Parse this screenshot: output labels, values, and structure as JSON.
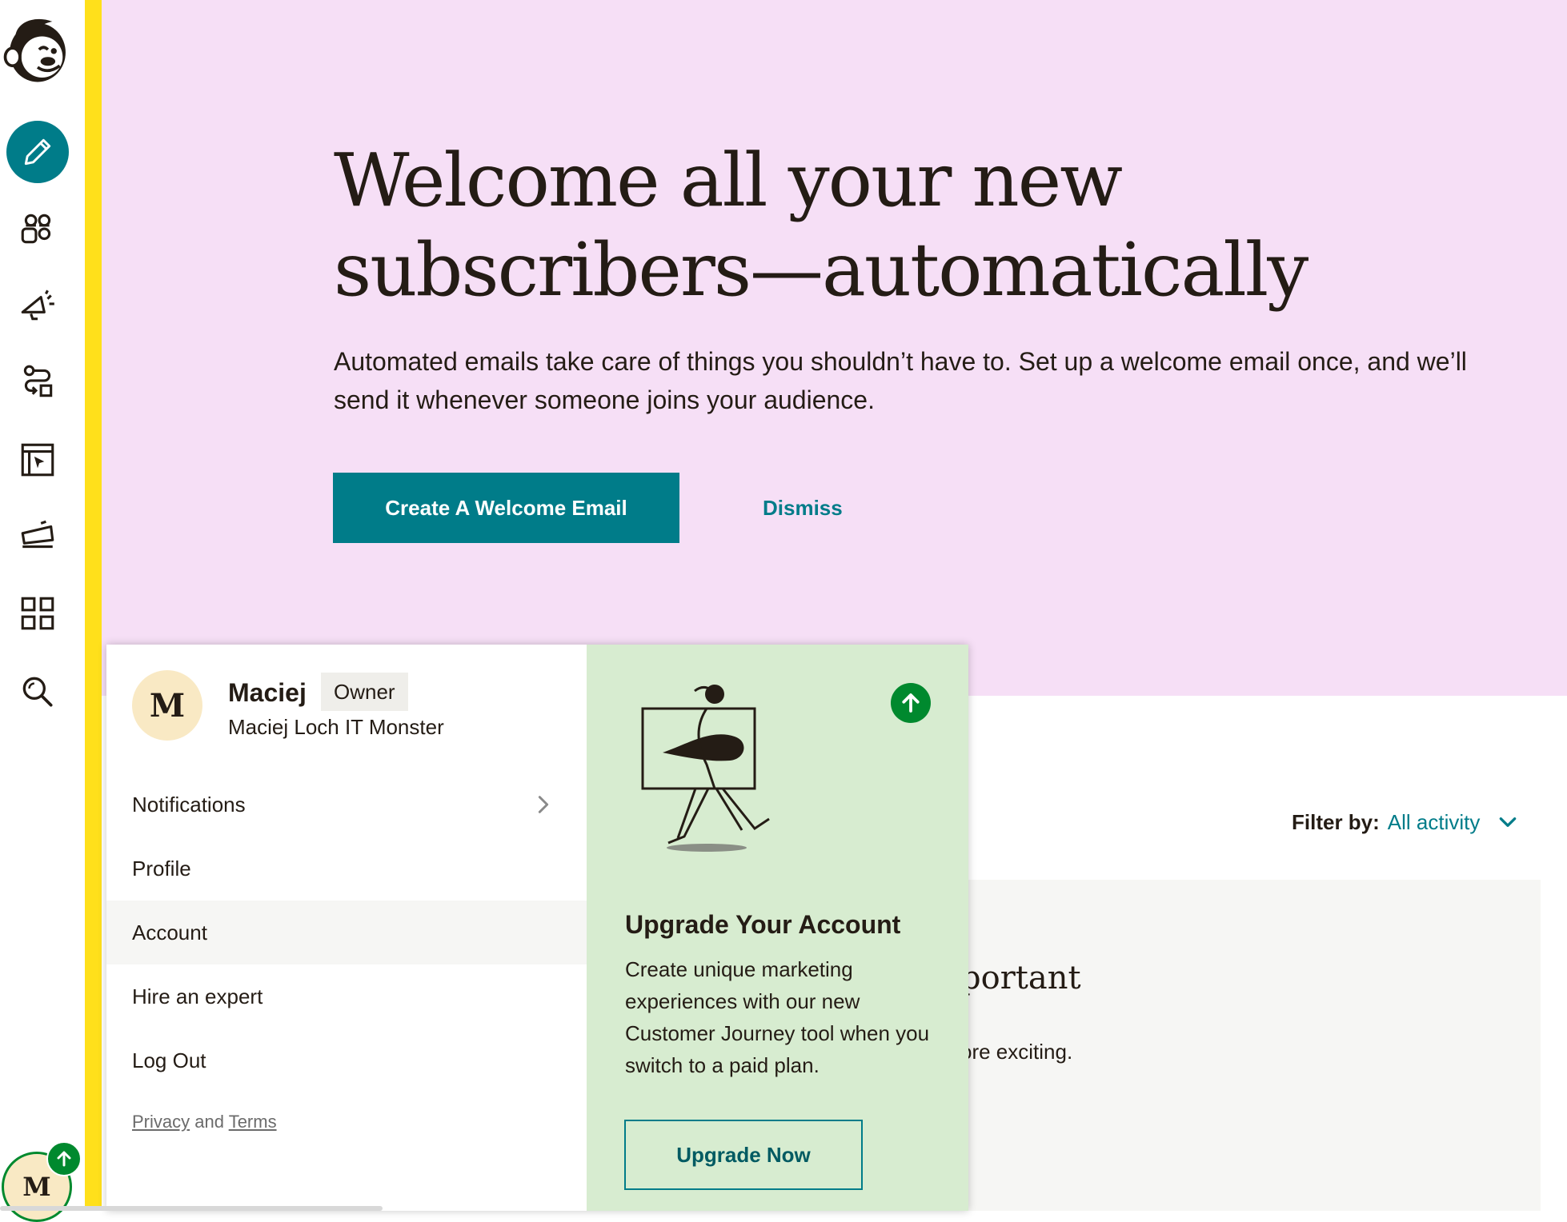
{
  "colors": {
    "accent": "#007c89",
    "yellow_stripe": "#ffe01b",
    "hero_bg": "#f6dff6",
    "upgrade_bg": "#d7ecd0",
    "success": "#00892e"
  },
  "nav": {
    "items": [
      {
        "name": "create",
        "icon": "pencil-icon"
      },
      {
        "name": "audience",
        "icon": "audience-icon"
      },
      {
        "name": "campaigns",
        "icon": "megaphone-icon"
      },
      {
        "name": "automations",
        "icon": "automation-icon"
      },
      {
        "name": "website",
        "icon": "website-cursor-icon"
      },
      {
        "name": "content",
        "icon": "content-icon"
      },
      {
        "name": "integrations",
        "icon": "grid-icon"
      },
      {
        "name": "search",
        "icon": "search-icon"
      }
    ],
    "avatar_initial": "M"
  },
  "hero": {
    "title": "Welcome all your new subscribers—automatically",
    "body": "Automated emails take care of things you shouldn’t have to. Set up a welcome email once, and we’ll send it whenever someone joins your audience.",
    "cta_label": "Create A Welcome Email",
    "dismiss_label": "Dismiss"
  },
  "filter": {
    "label": "Filter by:",
    "value": "All activity"
  },
  "activity": {
    "heading_fragment": "portant",
    "text_fragment": "ore exciting."
  },
  "account_menu": {
    "avatar_initial": "M",
    "name": "Maciej",
    "role": "Owner",
    "organization": "Maciej Loch IT Monster",
    "items": [
      {
        "label": "Notifications",
        "has_submenu": true
      },
      {
        "label": "Profile"
      },
      {
        "label": "Account",
        "active": true
      },
      {
        "label": "Hire an expert"
      },
      {
        "label": "Log Out"
      }
    ],
    "legal": {
      "privacy": "Privacy",
      "and": "and",
      "terms": "Terms"
    }
  },
  "upgrade": {
    "title": "Upgrade Your Account",
    "text": "Create unique marketing experiences with our new Customer Journey tool when you switch to a paid plan.",
    "button_label": "Upgrade Now"
  }
}
